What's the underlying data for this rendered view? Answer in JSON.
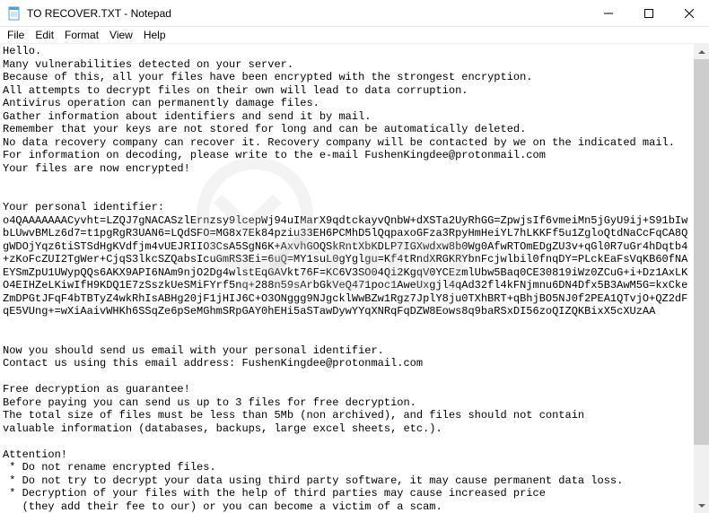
{
  "window": {
    "title": "TO RECOVER.TXT - Notepad"
  },
  "menu": {
    "file": "File",
    "edit": "Edit",
    "format": "Format",
    "view": "View",
    "help": "Help"
  },
  "body": {
    "text": "Hello.\nMany vulnerabilities detected on your server.\nBecause of this, all your files have been encrypted with the strongest encryption.\nAll attempts to decrypt files on their own will lead to data corruption.\nAntivirus operation can permanently damage files.\nGather information about identifiers and send it by mail.\nRemember that your keys are not stored for long and can be automatically deleted.\nNo data recovery company can recover it. Recovery company will be contacted by we on the indicated mail.\nFor information on decoding, please write to the e-mail FushenKingdee@protonmail.com\nYour files are now encrypted!\n\n\nYour personal identifier:\no4QAAAAAAACyvht=LZQJ7gNACASzlErnzsy9lcepWj94uIMarX9qdtckayvQnbW+dXSTa2UyRhGG=ZpwjsIf6vmeiMn5jGyU9ij+S91bIwbLUwvBMLz6d7=t1pgRgR3UAN6=LQdSFO=MG8x7Ek84pziu33EH6PCMhD5lQqpaxoGFza3RpyHmHeiYL7hLKKFf5u1ZgloQtdNaCcFqCA8QgWDOjYqz6tiSTSdHgKVdfjm4vUEJRIIO3CsA5SgN6K+AxvhGOQSkRntXbKDLP7IGXwdxw8b0Wg0AfwRTOmEDgZU3v+qGl0R7uGr4hDqtb4+zKoFcZUI2TgWer+CjqS3lkcSZQabsIcuGmRS3Ei=6uQ=MY1suL0gYglgu=Kf4tRndXRGKRYbnFcjwlbil0fnqDY=PLckEaFsVqKB60fNAEYSmZpU1UWypQQs6AKX9API6NAm9njO2Dg4wlstEqGAVkt76F=KC6V3SO04Qi2KgqV0YCEzmlUbw5Baq0CE30819iWz0ZCuG+i+Dz1AxLKO4EIHZeLKiwIfH9KDQ1E7zSszkUeSMiFYrf5nq+288n59sArbGkVeQ471poc1AweUxgjl4qAd32fl4kFNjmnu6DN4Dfx5B3AwM5G=kxCkeZmDPGtJFqF4bTBTyZ4wkRhIsABHg20jF1jHIJ6C+O3ONggg9NJgcklWwBZw1Rgz7JplY8ju0TXhBRT+qBhjBO5NJ0f2PEA1QTvjO+QZ2dFqE5VUng+=wXiAaivWHKh6SSqZe6pSeMGhmSRpGAY0hEHi5aSTawDywYYqXNRqFqDZW8Eows8q9baRSxDI56zoQIZQKBixX5cXUzAA\n\n\nNow you should send us email with your personal identifier.\nContact us using this email address: FushenKingdee@protonmail.com\n\nFree decryption as guarantee!\nBefore paying you can send us up to 3 files for free decryption.\nThe total size of files must be less than 5Mb (non archived), and files should not contain\nvaluable information (databases, backups, large excel sheets, etc.).\n\nAttention!\n * Do not rename encrypted files.\n * Do not try to decrypt your data using third party software, it may cause permanent data loss.\n * Decryption of your files with the help of third parties may cause increased price\n   (they add their fee to our) or you can become a victim of a scam."
  }
}
